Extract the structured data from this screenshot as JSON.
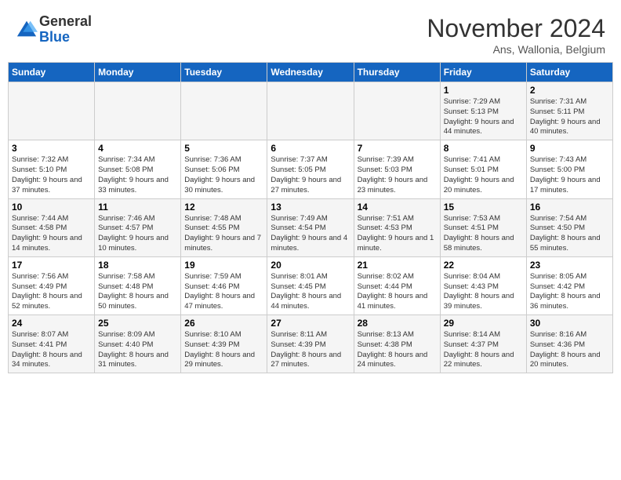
{
  "header": {
    "logo_line1": "General",
    "logo_line2": "Blue",
    "month_title": "November 2024",
    "location": "Ans, Wallonia, Belgium"
  },
  "weekdays": [
    "Sunday",
    "Monday",
    "Tuesday",
    "Wednesday",
    "Thursday",
    "Friday",
    "Saturday"
  ],
  "weeks": [
    [
      {
        "day": "",
        "sunrise": "",
        "sunset": "",
        "daylight": ""
      },
      {
        "day": "",
        "sunrise": "",
        "sunset": "",
        "daylight": ""
      },
      {
        "day": "",
        "sunrise": "",
        "sunset": "",
        "daylight": ""
      },
      {
        "day": "",
        "sunrise": "",
        "sunset": "",
        "daylight": ""
      },
      {
        "day": "",
        "sunrise": "",
        "sunset": "",
        "daylight": ""
      },
      {
        "day": "1",
        "sunrise": "Sunrise: 7:29 AM",
        "sunset": "Sunset: 5:13 PM",
        "daylight": "Daylight: 9 hours and 44 minutes."
      },
      {
        "day": "2",
        "sunrise": "Sunrise: 7:31 AM",
        "sunset": "Sunset: 5:11 PM",
        "daylight": "Daylight: 9 hours and 40 minutes."
      }
    ],
    [
      {
        "day": "3",
        "sunrise": "Sunrise: 7:32 AM",
        "sunset": "Sunset: 5:10 PM",
        "daylight": "Daylight: 9 hours and 37 minutes."
      },
      {
        "day": "4",
        "sunrise": "Sunrise: 7:34 AM",
        "sunset": "Sunset: 5:08 PM",
        "daylight": "Daylight: 9 hours and 33 minutes."
      },
      {
        "day": "5",
        "sunrise": "Sunrise: 7:36 AM",
        "sunset": "Sunset: 5:06 PM",
        "daylight": "Daylight: 9 hours and 30 minutes."
      },
      {
        "day": "6",
        "sunrise": "Sunrise: 7:37 AM",
        "sunset": "Sunset: 5:05 PM",
        "daylight": "Daylight: 9 hours and 27 minutes."
      },
      {
        "day": "7",
        "sunrise": "Sunrise: 7:39 AM",
        "sunset": "Sunset: 5:03 PM",
        "daylight": "Daylight: 9 hours and 23 minutes."
      },
      {
        "day": "8",
        "sunrise": "Sunrise: 7:41 AM",
        "sunset": "Sunset: 5:01 PM",
        "daylight": "Daylight: 9 hours and 20 minutes."
      },
      {
        "day": "9",
        "sunrise": "Sunrise: 7:43 AM",
        "sunset": "Sunset: 5:00 PM",
        "daylight": "Daylight: 9 hours and 17 minutes."
      }
    ],
    [
      {
        "day": "10",
        "sunrise": "Sunrise: 7:44 AM",
        "sunset": "Sunset: 4:58 PM",
        "daylight": "Daylight: 9 hours and 14 minutes."
      },
      {
        "day": "11",
        "sunrise": "Sunrise: 7:46 AM",
        "sunset": "Sunset: 4:57 PM",
        "daylight": "Daylight: 9 hours and 10 minutes."
      },
      {
        "day": "12",
        "sunrise": "Sunrise: 7:48 AM",
        "sunset": "Sunset: 4:55 PM",
        "daylight": "Daylight: 9 hours and 7 minutes."
      },
      {
        "day": "13",
        "sunrise": "Sunrise: 7:49 AM",
        "sunset": "Sunset: 4:54 PM",
        "daylight": "Daylight: 9 hours and 4 minutes."
      },
      {
        "day": "14",
        "sunrise": "Sunrise: 7:51 AM",
        "sunset": "Sunset: 4:53 PM",
        "daylight": "Daylight: 9 hours and 1 minute."
      },
      {
        "day": "15",
        "sunrise": "Sunrise: 7:53 AM",
        "sunset": "Sunset: 4:51 PM",
        "daylight": "Daylight: 8 hours and 58 minutes."
      },
      {
        "day": "16",
        "sunrise": "Sunrise: 7:54 AM",
        "sunset": "Sunset: 4:50 PM",
        "daylight": "Daylight: 8 hours and 55 minutes."
      }
    ],
    [
      {
        "day": "17",
        "sunrise": "Sunrise: 7:56 AM",
        "sunset": "Sunset: 4:49 PM",
        "daylight": "Daylight: 8 hours and 52 minutes."
      },
      {
        "day": "18",
        "sunrise": "Sunrise: 7:58 AM",
        "sunset": "Sunset: 4:48 PM",
        "daylight": "Daylight: 8 hours and 50 minutes."
      },
      {
        "day": "19",
        "sunrise": "Sunrise: 7:59 AM",
        "sunset": "Sunset: 4:46 PM",
        "daylight": "Daylight: 8 hours and 47 minutes."
      },
      {
        "day": "20",
        "sunrise": "Sunrise: 8:01 AM",
        "sunset": "Sunset: 4:45 PM",
        "daylight": "Daylight: 8 hours and 44 minutes."
      },
      {
        "day": "21",
        "sunrise": "Sunrise: 8:02 AM",
        "sunset": "Sunset: 4:44 PM",
        "daylight": "Daylight: 8 hours and 41 minutes."
      },
      {
        "day": "22",
        "sunrise": "Sunrise: 8:04 AM",
        "sunset": "Sunset: 4:43 PM",
        "daylight": "Daylight: 8 hours and 39 minutes."
      },
      {
        "day": "23",
        "sunrise": "Sunrise: 8:05 AM",
        "sunset": "Sunset: 4:42 PM",
        "daylight": "Daylight: 8 hours and 36 minutes."
      }
    ],
    [
      {
        "day": "24",
        "sunrise": "Sunrise: 8:07 AM",
        "sunset": "Sunset: 4:41 PM",
        "daylight": "Daylight: 8 hours and 34 minutes."
      },
      {
        "day": "25",
        "sunrise": "Sunrise: 8:09 AM",
        "sunset": "Sunset: 4:40 PM",
        "daylight": "Daylight: 8 hours and 31 minutes."
      },
      {
        "day": "26",
        "sunrise": "Sunrise: 8:10 AM",
        "sunset": "Sunset: 4:39 PM",
        "daylight": "Daylight: 8 hours and 29 minutes."
      },
      {
        "day": "27",
        "sunrise": "Sunrise: 8:11 AM",
        "sunset": "Sunset: 4:39 PM",
        "daylight": "Daylight: 8 hours and 27 minutes."
      },
      {
        "day": "28",
        "sunrise": "Sunrise: 8:13 AM",
        "sunset": "Sunset: 4:38 PM",
        "daylight": "Daylight: 8 hours and 24 minutes."
      },
      {
        "day": "29",
        "sunrise": "Sunrise: 8:14 AM",
        "sunset": "Sunset: 4:37 PM",
        "daylight": "Daylight: 8 hours and 22 minutes."
      },
      {
        "day": "30",
        "sunrise": "Sunrise: 8:16 AM",
        "sunset": "Sunset: 4:36 PM",
        "daylight": "Daylight: 8 hours and 20 minutes."
      }
    ]
  ]
}
